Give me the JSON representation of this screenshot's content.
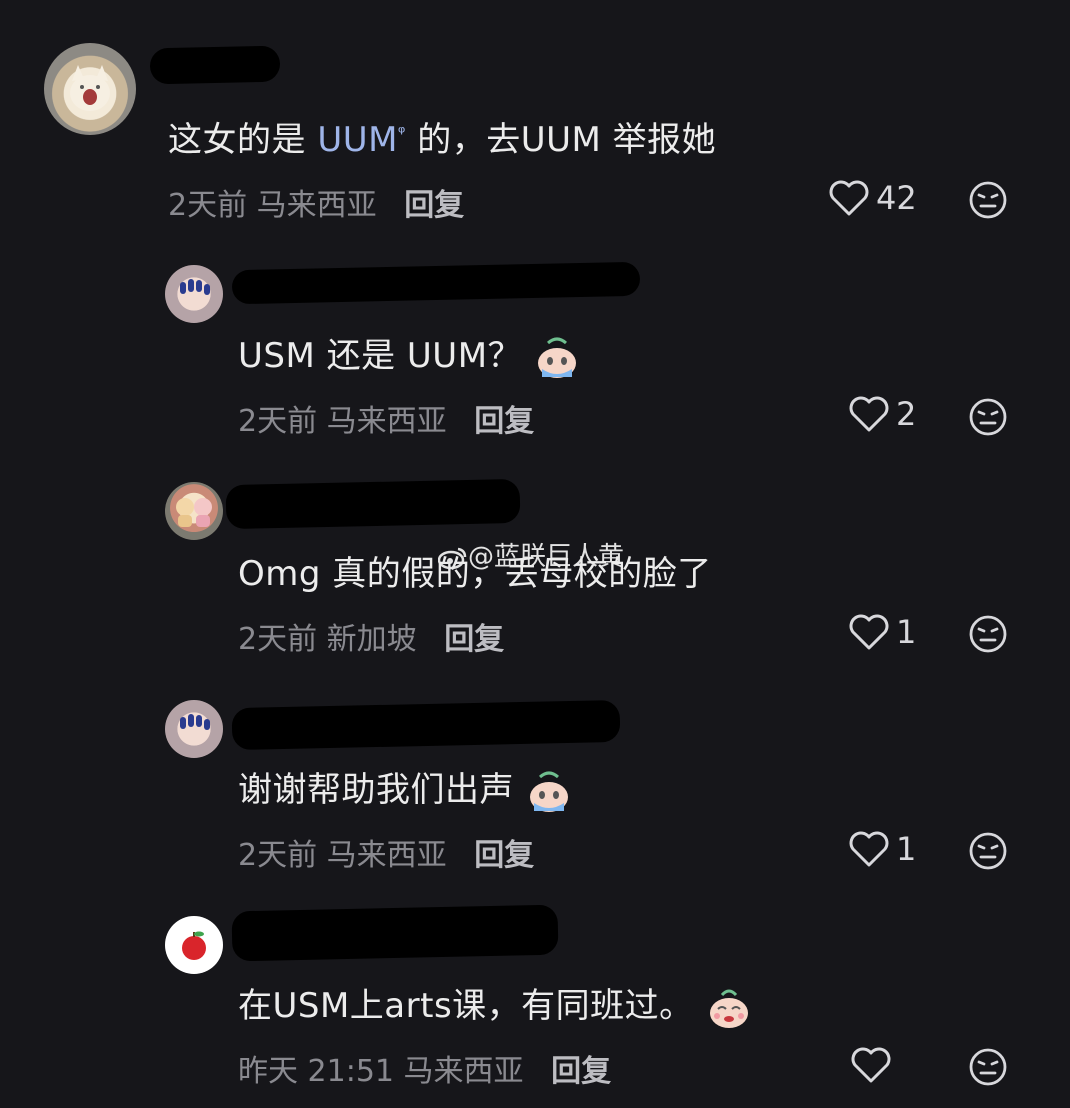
{
  "watermark": "@蓝朕巨人黄",
  "comments": [
    {
      "text": "这女的是",
      "link_text": "UUM",
      "text_after": " 的，去UUM 举报她",
      "time": "2天前",
      "location": "马来西亚",
      "reply_label": "回复",
      "likes": "42"
    },
    {
      "text": "USM 还是 UUM？",
      "time": "2天前",
      "location": "马来西亚",
      "reply_label": "回复",
      "likes": "2"
    },
    {
      "text": "Omg 真的假的，丢母校的脸了",
      "time": "2天前",
      "location": "新加坡",
      "reply_label": "回复",
      "likes": "1"
    },
    {
      "text": "谢谢帮助我们出声",
      "time": "2天前",
      "location": "马来西亚",
      "reply_label": "回复",
      "likes": "1"
    },
    {
      "text": "在USM上arts课，有同班过。",
      "time": "昨天 21:51",
      "location": "马来西亚",
      "reply_label": "回复",
      "likes": ""
    }
  ]
}
